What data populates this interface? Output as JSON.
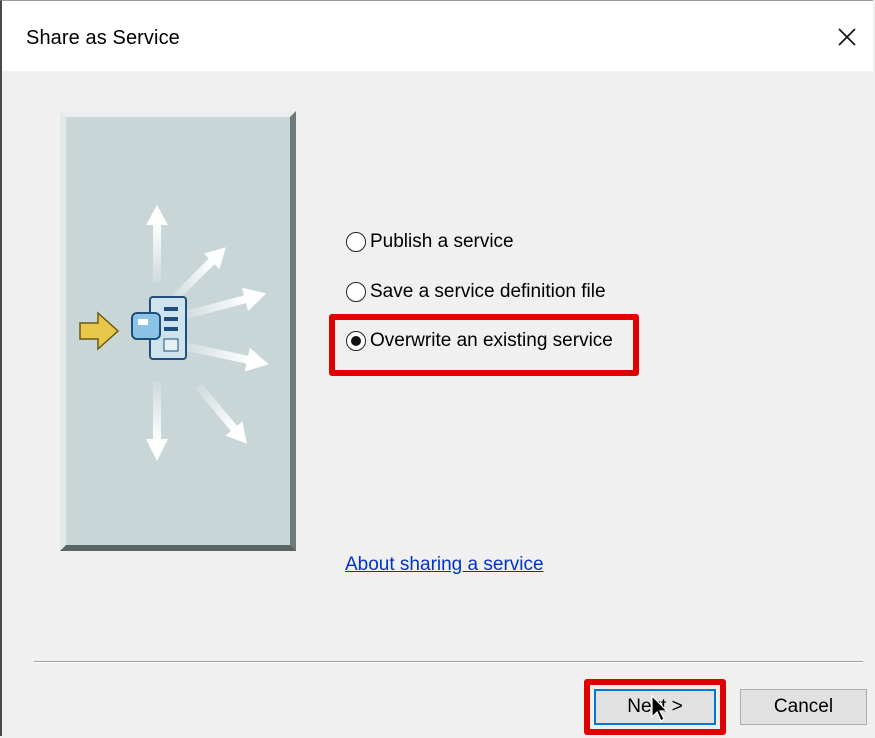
{
  "window": {
    "title": "Share as Service",
    "close_glyph": "✕"
  },
  "options": [
    {
      "label": "Publish a service",
      "selected": false
    },
    {
      "label": "Save a service definition file",
      "selected": false
    },
    {
      "label": "Overwrite an existing service",
      "selected": true
    }
  ],
  "about_link": "About sharing a service",
  "buttons": {
    "next": "Next >",
    "cancel": "Cancel"
  },
  "colors": {
    "highlight": "#e00000",
    "link": "#0033cc",
    "panel": "#c9d6d8",
    "arrow_in": "#e8c84a"
  },
  "icons": [
    "close-icon",
    "share-service-illustration",
    "server-icon",
    "arrow-right-icon",
    "mouse-cursor-icon"
  ]
}
